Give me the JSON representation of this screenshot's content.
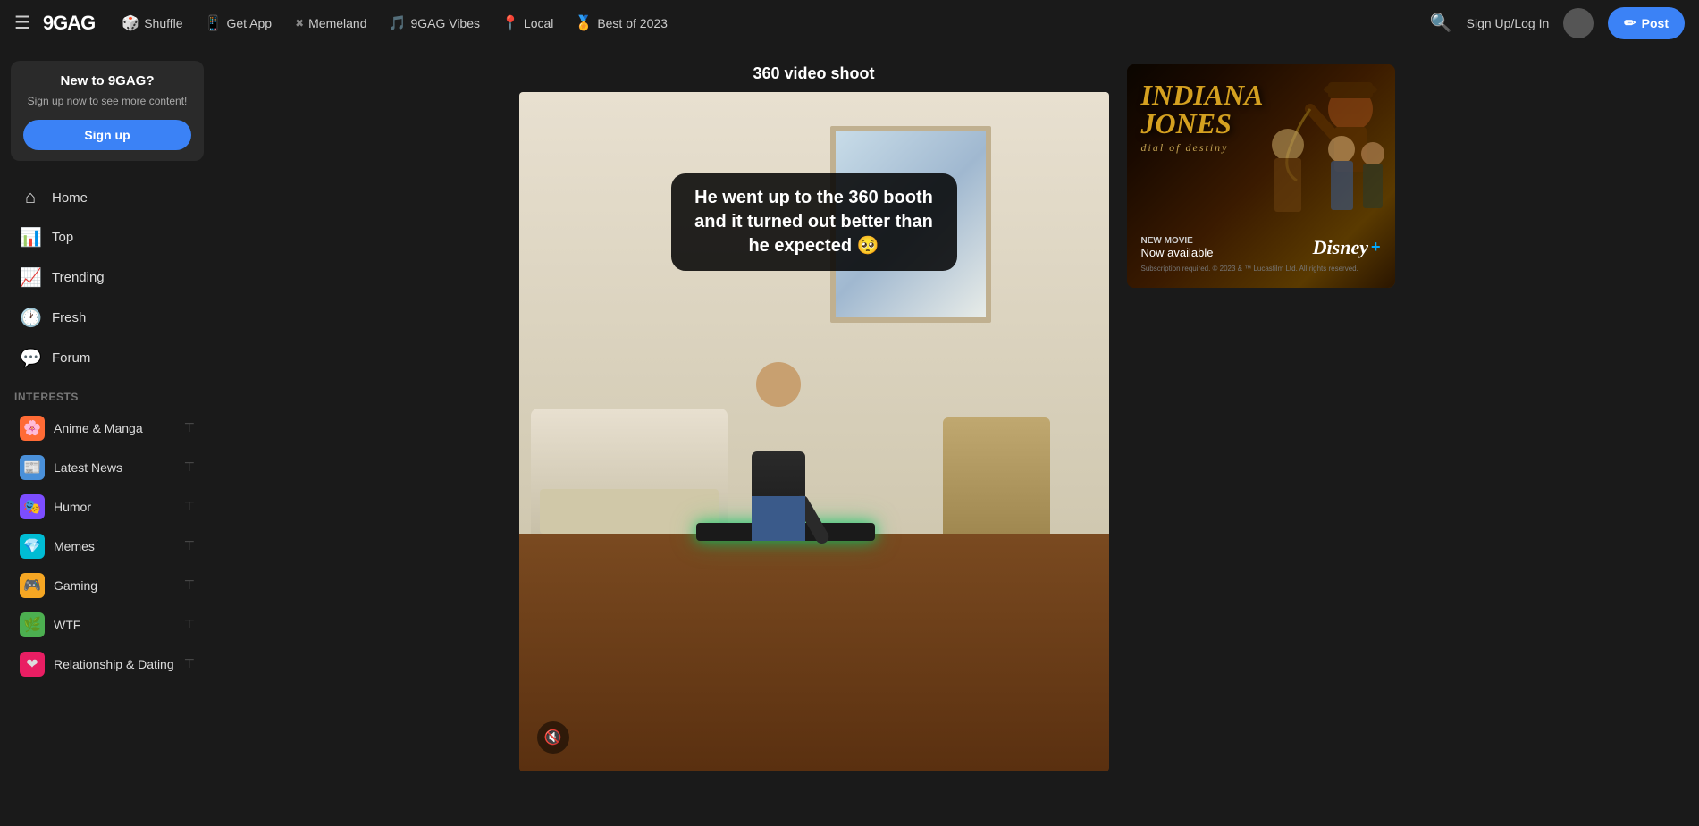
{
  "site": {
    "logo": "9GAG",
    "name": "9GAG"
  },
  "topnav": {
    "hamburger": "☰",
    "shuffle_label": "Shuffle",
    "get_app_label": "Get App",
    "memeland_label": "Memeland",
    "vibes_label": "9GAG Vibes",
    "local_label": "Local",
    "best_of_2023_label": "Best of 2023",
    "signup_login": "Sign Up/Log In",
    "post_label": "Post",
    "emojis": {
      "shuffle": "🎲",
      "get_app": "📱",
      "memeland": "✖",
      "vibes": "🎵",
      "local": "📍",
      "best_of_2023": "🏅"
    }
  },
  "sidebar": {
    "signup_box": {
      "title": "New to 9GAG?",
      "description": "Sign up now to see more content!",
      "button_label": "Sign up"
    },
    "nav_items": [
      {
        "id": "home",
        "label": "Home",
        "icon": "⌂"
      },
      {
        "id": "top",
        "label": "Top",
        "icon": "📊"
      },
      {
        "id": "trending",
        "label": "Trending",
        "icon": "📈"
      },
      {
        "id": "fresh",
        "label": "Fresh",
        "icon": "🕐"
      },
      {
        "id": "forum",
        "label": "Forum",
        "icon": "💬"
      }
    ],
    "interests_label": "Interests",
    "interests": [
      {
        "id": "anime",
        "label": "Anime & Manga",
        "icon": "🌸",
        "color": "ic-anime"
      },
      {
        "id": "latest-news",
        "label": "Latest News",
        "icon": "📰",
        "color": "ic-news"
      },
      {
        "id": "humor",
        "label": "Humor",
        "icon": "🎭",
        "color": "ic-humor"
      },
      {
        "id": "memes",
        "label": "Memes",
        "icon": "💎",
        "color": "ic-memes"
      },
      {
        "id": "gaming",
        "label": "Gaming",
        "icon": "🎮",
        "color": "ic-gaming"
      },
      {
        "id": "wtf",
        "label": "WTF",
        "icon": "🌿",
        "color": "ic-wtf"
      },
      {
        "id": "relationship",
        "label": "Relationship & Dating",
        "icon": "❤",
        "color": "ic-relationship"
      }
    ]
  },
  "post": {
    "title": "360 video shoot",
    "caption": "He went up to the 360 booth and it turned out better than he expected 🥺",
    "mute_icon": "🔇"
  },
  "ad": {
    "title": "INDIANA\nJONES",
    "subtitle": "dial of destiny",
    "new_movie_label": "NEW MOVIE",
    "available_label": "Now available",
    "disney_label": "Disney+",
    "subscription_note": "Subscription required. © 2023 & ™ Lucasfilm Ltd. All rights reserved."
  }
}
